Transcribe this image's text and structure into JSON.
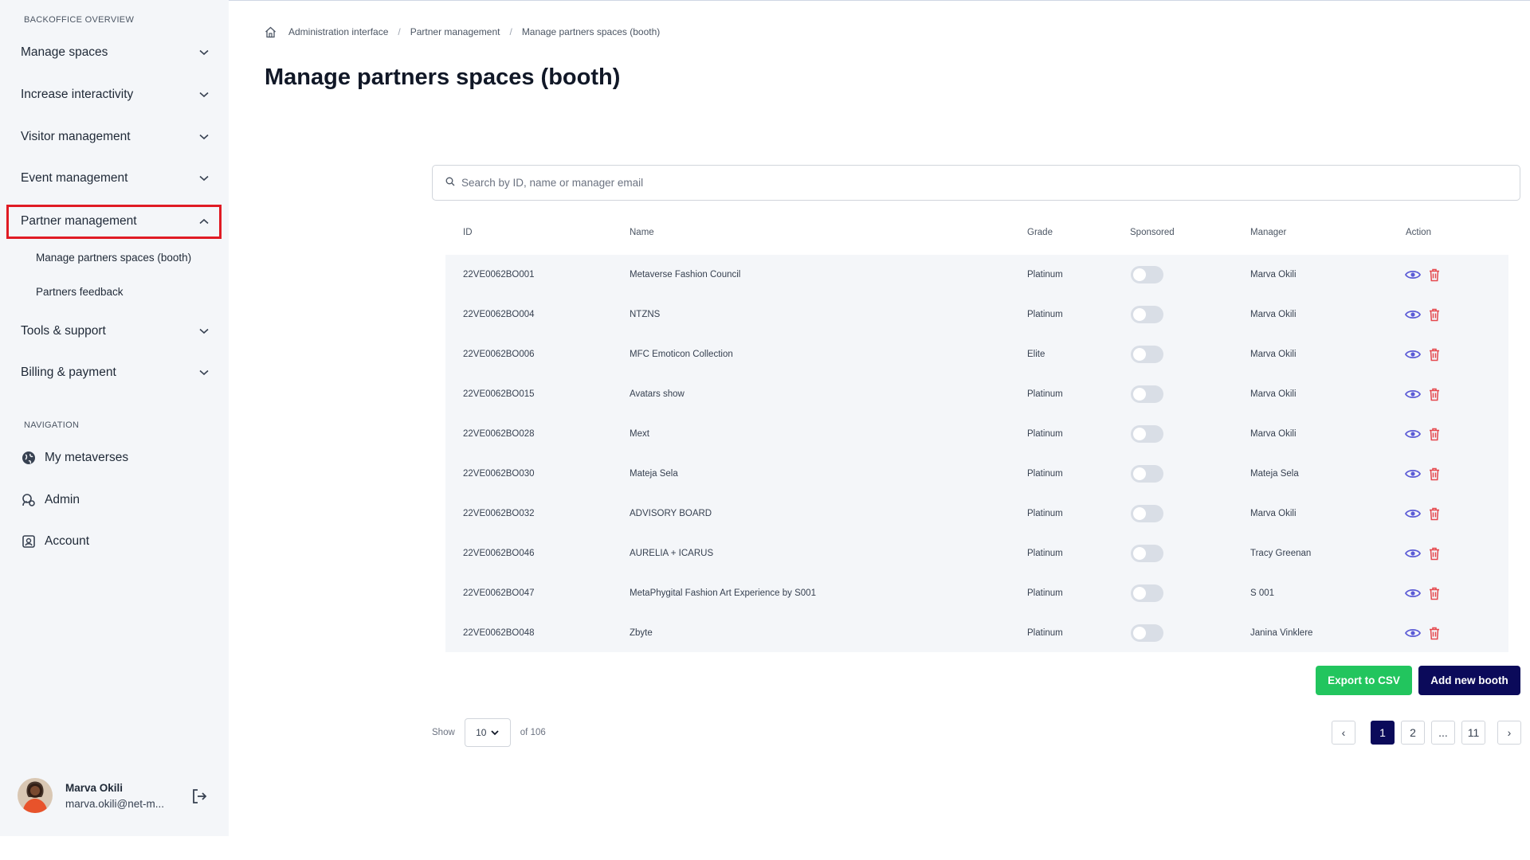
{
  "sidebar": {
    "section_backoffice": "BACKOFFICE OVERVIEW",
    "items": [
      {
        "label": "Manage spaces"
      },
      {
        "label": "Increase interactivity"
      },
      {
        "label": "Visitor management"
      },
      {
        "label": "Event management"
      },
      {
        "label": "Partner management",
        "expanded": true
      },
      {
        "label": "Tools & support"
      },
      {
        "label": "Billing & payment"
      }
    ],
    "sub_items": [
      {
        "label": "Manage partners spaces (booth)"
      },
      {
        "label": "Partners feedback"
      }
    ],
    "section_navigation": "NAVIGATION",
    "nav": [
      {
        "label": "My metaverses",
        "icon": "globe-icon"
      },
      {
        "label": "Admin",
        "icon": "admin-icon"
      },
      {
        "label": "Account",
        "icon": "account-icon"
      }
    ],
    "user": {
      "name": "Marva Okili",
      "email": "marva.okili@net-m..."
    }
  },
  "breadcrumb": [
    "Administration interface",
    "Partner management",
    "Manage partners spaces (booth)"
  ],
  "page_title": "Manage partners spaces (booth)",
  "search": {
    "placeholder": "Search by ID, name or manager email"
  },
  "table": {
    "headers": {
      "id": "ID",
      "name": "Name",
      "grade": "Grade",
      "sponsored": "Sponsored",
      "manager": "Manager",
      "action": "Action"
    },
    "rows": [
      {
        "id": "22VE0062BO001",
        "name": "Metaverse Fashion Council",
        "grade": "Platinum",
        "sponsored": false,
        "manager": "Marva Okili"
      },
      {
        "id": "22VE0062BO004",
        "name": "NTZNS",
        "grade": "Platinum",
        "sponsored": false,
        "manager": "Marva Okili"
      },
      {
        "id": "22VE0062BO006",
        "name": "MFC Emoticon Collection",
        "grade": "Elite",
        "sponsored": false,
        "manager": "Marva Okili"
      },
      {
        "id": "22VE0062BO015",
        "name": "Avatars show",
        "grade": "Platinum",
        "sponsored": false,
        "manager": "Marva Okili"
      },
      {
        "id": "22VE0062BO028",
        "name": "Mext",
        "grade": "Platinum",
        "sponsored": false,
        "manager": "Marva Okili"
      },
      {
        "id": "22VE0062BO030",
        "name": "Mateja Sela",
        "grade": "Platinum",
        "sponsored": false,
        "manager": "Mateja Sela"
      },
      {
        "id": "22VE0062BO032",
        "name": "ADVISORY BOARD",
        "grade": "Platinum",
        "sponsored": false,
        "manager": "Marva Okili"
      },
      {
        "id": "22VE0062BO046",
        "name": "AURELIA + ICARUS",
        "grade": "Platinum",
        "sponsored": false,
        "manager": "Tracy Greenan"
      },
      {
        "id": "22VE0062BO047",
        "name": "MetaPhygital Fashion Art Experience by S001",
        "grade": "Platinum",
        "sponsored": false,
        "manager": "S 001"
      },
      {
        "id": "22VE0062BO048",
        "name": "Zbyte",
        "grade": "Platinum",
        "sponsored": false,
        "manager": "Janina Vinklere"
      }
    ]
  },
  "buttons": {
    "export": "Export to CSV",
    "add": "Add new booth"
  },
  "pagination": {
    "show_label": "Show",
    "page_size": "10",
    "total_label": "of 106",
    "prev": "‹",
    "next": "›",
    "pages": [
      "1",
      "2",
      "...",
      "11"
    ],
    "current": "1"
  },
  "colors": {
    "highlight_border": "#e01b24",
    "export_button": "#22c55e",
    "primary_button": "#0b0a5a",
    "view_icon": "#5b5bd6",
    "delete_icon": "#e5484d",
    "sidebar_bg": "#f4f6f9"
  }
}
